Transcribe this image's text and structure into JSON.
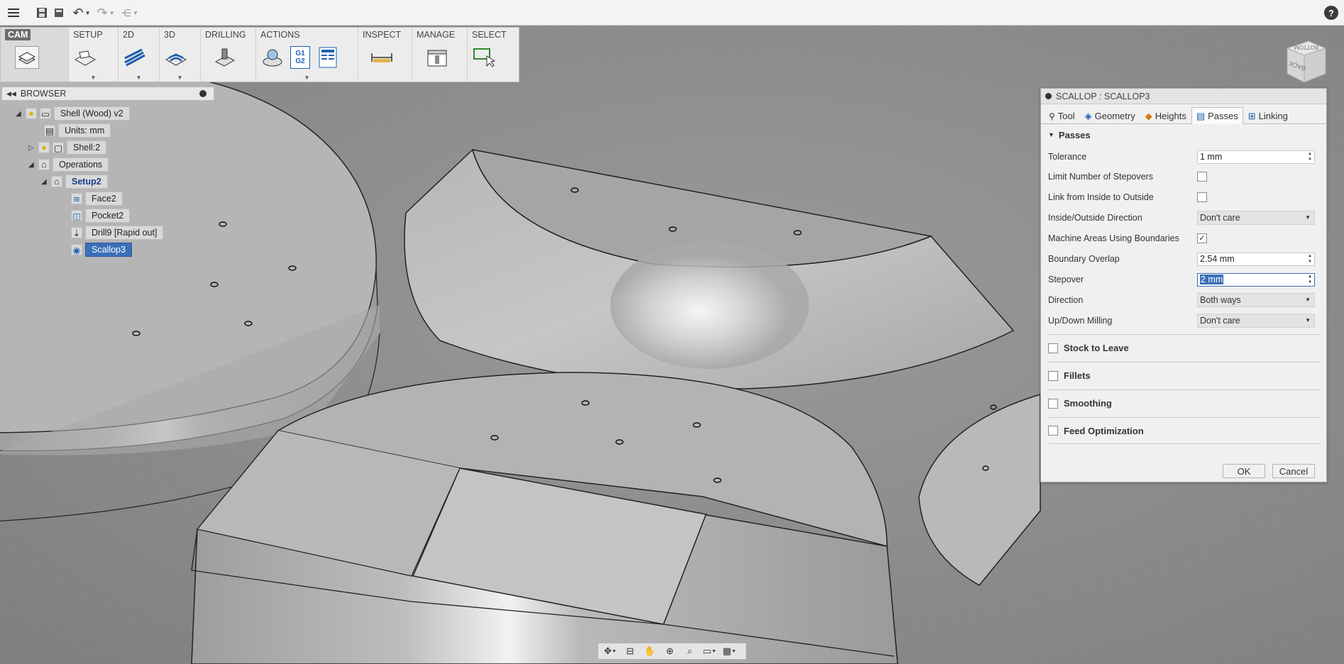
{
  "toolbar": {
    "menu_icon": "hamburger-icon",
    "save_icon": "save-icon",
    "help_label": "?"
  },
  "ribbon": {
    "workspace": "CAM",
    "groups": [
      "SETUP",
      "2D",
      "3D",
      "DRILLING",
      "ACTIONS",
      "INSPECT",
      "MANAGE",
      "SELECT"
    ],
    "actions_g1g2_top": "G1",
    "actions_g1g2_bottom": "G2"
  },
  "browser": {
    "title": "BROWSER",
    "items": [
      {
        "label": "Shell (Wood) v2"
      },
      {
        "label": "Units: mm"
      },
      {
        "label": "Shell:2"
      },
      {
        "label": "Operations"
      },
      {
        "label": "Setup2"
      },
      {
        "label": "Face2"
      },
      {
        "label": "Pocket2"
      },
      {
        "label": "Drill9 [Rapid out]"
      },
      {
        "label": "Scallop3"
      }
    ]
  },
  "dialog": {
    "title": "SCALLOP : SCALLOP3",
    "tabs": [
      "Tool",
      "Geometry",
      "Heights",
      "Passes",
      "Linking"
    ],
    "active_tab": "Passes",
    "section_title": "Passes",
    "fields": {
      "tolerance": {
        "label": "Tolerance",
        "value": "1 mm"
      },
      "limit_stepovers": {
        "label": "Limit Number of Stepovers",
        "checked": false
      },
      "link_inside_outside": {
        "label": "Link from Inside to Outside",
        "checked": false
      },
      "inside_outside_direction": {
        "label": "Inside/Outside Direction",
        "value": "Don't care"
      },
      "machine_areas_boundaries": {
        "label": "Machine Areas Using Boundaries",
        "checked": true
      },
      "boundary_overlap": {
        "label": "Boundary Overlap",
        "value": "2.54 mm"
      },
      "stepover": {
        "label": "Stepover",
        "value": "2 mm"
      },
      "direction": {
        "label": "Direction",
        "value": "Both ways"
      },
      "updown_milling": {
        "label": "Up/Down Milling",
        "value": "Don't care"
      }
    },
    "groups": [
      "Stock to Leave",
      "Fillets",
      "Smoothing",
      "Feed Optimization"
    ],
    "ok_label": "OK",
    "cancel_label": "Cancel"
  },
  "viewcube": {
    "face_top": "BOTTOM",
    "face_side": "BACK"
  },
  "colors": {
    "background": "#8a8a8a",
    "selection": "#3b6fb8",
    "dialog_bg": "#f0f0f0",
    "ribbon_bg": "#ececec"
  }
}
